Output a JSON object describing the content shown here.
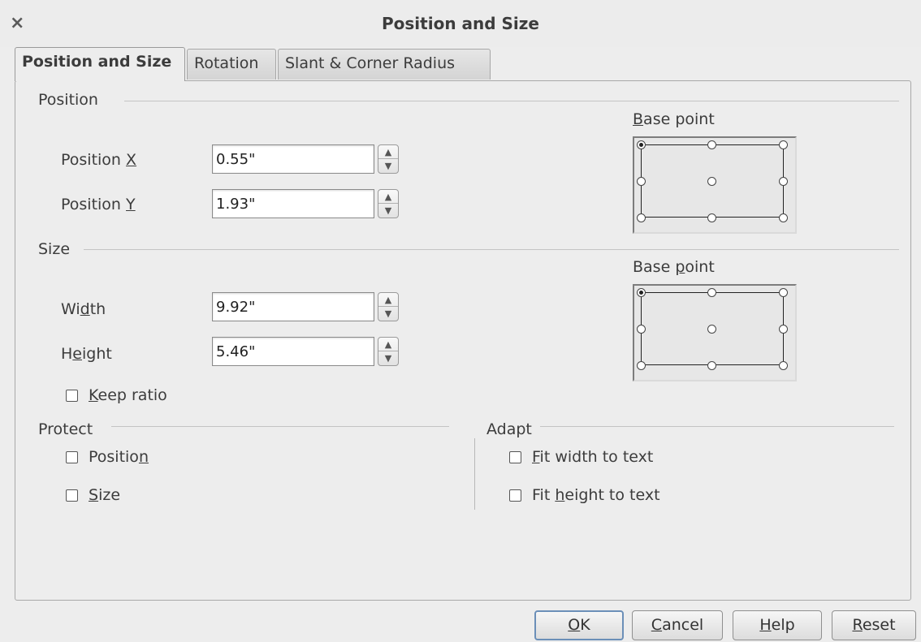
{
  "window": {
    "title": "Position and Size",
    "close_glyph": "×"
  },
  "tabs": [
    {
      "label": "Position and Size",
      "active": true
    },
    {
      "label": "Rotation",
      "active": false
    },
    {
      "label": "Slant & Corner Radius",
      "active": false
    }
  ],
  "position": {
    "heading": "Position",
    "x": {
      "label_pre": "Position ",
      "label_u": "X",
      "label_post": "",
      "value": "0.55\""
    },
    "y": {
      "label_pre": "Position ",
      "label_u": "Y",
      "label_post": "",
      "value": "1.93\""
    },
    "base_point": {
      "label_u": "B",
      "label_post": "ase point",
      "selected": "top-left"
    }
  },
  "size": {
    "heading": "Size",
    "width": {
      "label_pre": "Wi",
      "label_u": "d",
      "label_post": "th",
      "value": "9.92\""
    },
    "height": {
      "label_pre": "H",
      "label_u": "e",
      "label_post": "ight",
      "value": "5.46\""
    },
    "keep_ratio": {
      "label_u": "K",
      "label_post": "eep ratio",
      "checked": false
    },
    "base_point": {
      "label_pre": "Base ",
      "label_u": "p",
      "label_post": "oint",
      "selected": "top-left"
    }
  },
  "protect": {
    "heading": "Protect",
    "position": {
      "label_pre": "Positio",
      "label_u": "n",
      "checked": false
    },
    "size": {
      "label_u": "S",
      "label_post": "ize",
      "checked": false
    }
  },
  "adapt": {
    "heading": "Adapt",
    "fit_width": {
      "label_u": "F",
      "label_post": "it width to text",
      "checked": false
    },
    "fit_height": {
      "label_pre": "Fit ",
      "label_u": "h",
      "label_post": "eight to text",
      "checked": false
    }
  },
  "buttons": {
    "ok": {
      "label_u": "O",
      "label_post": "K"
    },
    "cancel": {
      "label_u": "C",
      "label_post": "ancel"
    },
    "help": {
      "label_u": "H",
      "label_post": "elp"
    },
    "reset": {
      "label_u": "R",
      "label_post": "eset"
    }
  },
  "spin_glyphs": {
    "up": "▲",
    "down": "▼"
  },
  "colors": {
    "dialog_bg": "#ededed",
    "default_button_border": "#6b8fb8"
  }
}
